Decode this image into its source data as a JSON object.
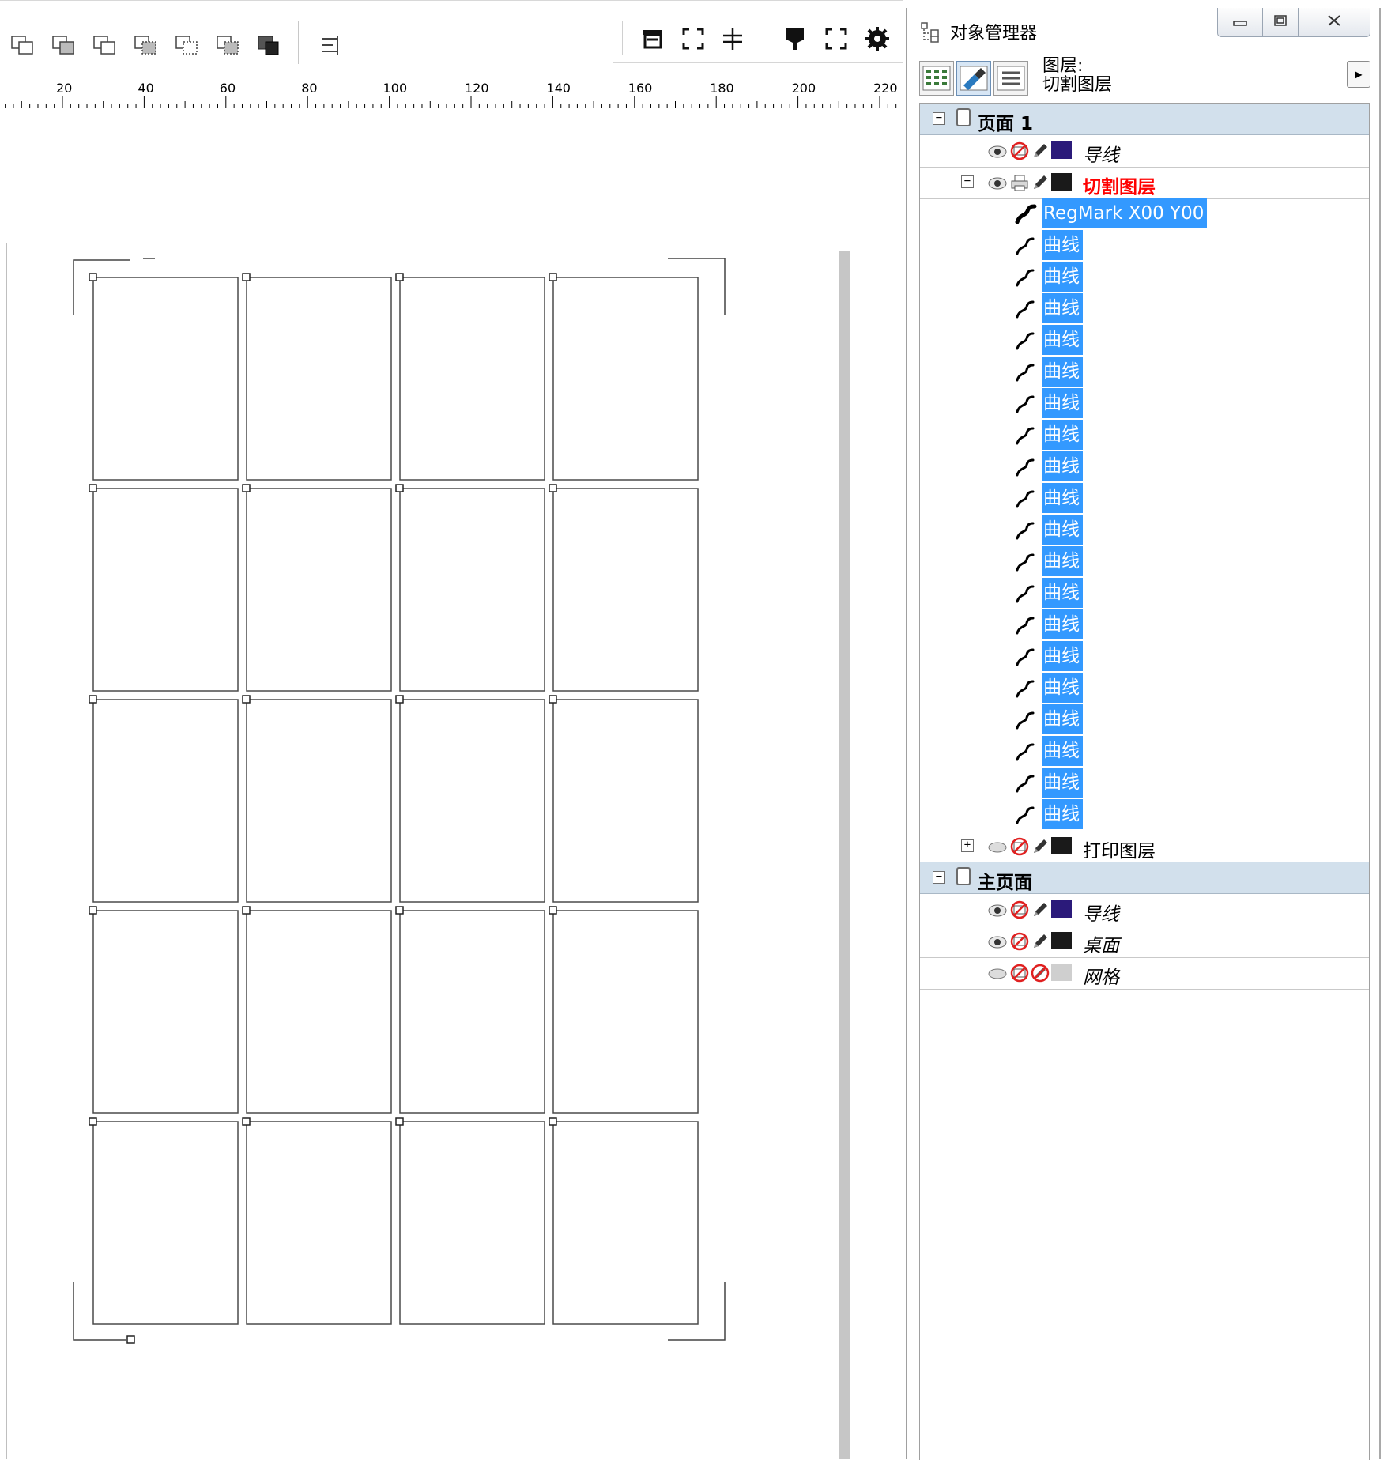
{
  "toolbar": {
    "left_icons": [
      "shaping-weld-icon",
      "shaping-trim-icon",
      "shaping-intersect-icon",
      "shaping-simplify-icon",
      "shaping-front-minus-back-icon",
      "shaping-back-minus-front-icon",
      "shaping-boundary-icon",
      "align-distribute-icon"
    ],
    "right_icons": [
      "plotter-icon",
      "frame-marks-icon",
      "crosshair-icon",
      "cutter-icon",
      "bounding-frame-icon",
      "settings-gear-icon"
    ]
  },
  "ruler": {
    "labels": [
      "20",
      "40",
      "60",
      "80",
      "100",
      "120",
      "140",
      "160",
      "180",
      "200",
      "220"
    ]
  },
  "canvas": {
    "grid_rows": 5,
    "grid_cols": 4
  },
  "panel": {
    "title": "对象管理器",
    "layer_caption_line1": "图层:",
    "layer_caption_line2": "切割图层",
    "view_buttons": [
      "show-properties-icon",
      "edit-across-layers-icon",
      "layer-manager-view-icon"
    ],
    "tree": {
      "page1": {
        "label": "页面 1",
        "layers": [
          {
            "name": "导线",
            "color": "#2b1a7a",
            "visible": true,
            "printable": false,
            "editable": true
          },
          {
            "name": "切割图层",
            "color": "#1a1a1a",
            "visible": true,
            "printable": true,
            "editable": true,
            "active": true,
            "objects": [
              "RegMark X00 Y00",
              "曲线",
              "曲线",
              "曲线",
              "曲线",
              "曲线",
              "曲线",
              "曲线",
              "曲线",
              "曲线",
              "曲线",
              "曲线",
              "曲线",
              "曲线",
              "曲线",
              "曲线",
              "曲线",
              "曲线",
              "曲线",
              "曲线"
            ]
          },
          {
            "name": "打印图层",
            "color": "#1a1a1a",
            "visible": false,
            "printable": false,
            "editable": true
          }
        ]
      },
      "master": {
        "label": "主页面",
        "layers": [
          {
            "name": "导线",
            "color": "#2b1a7a",
            "visible": true,
            "printable": false,
            "editable": true
          },
          {
            "name": "桌面",
            "color": "#1a1a1a",
            "visible": true,
            "printable": false,
            "editable": true
          },
          {
            "name": "网格",
            "color": "#cfcfcf",
            "visible": false,
            "printable": false,
            "editable": false
          }
        ]
      }
    },
    "colors": {
      "selection": "#3399ff",
      "active_layer": "#ff0000",
      "page_row": "#d2e0ec"
    }
  }
}
